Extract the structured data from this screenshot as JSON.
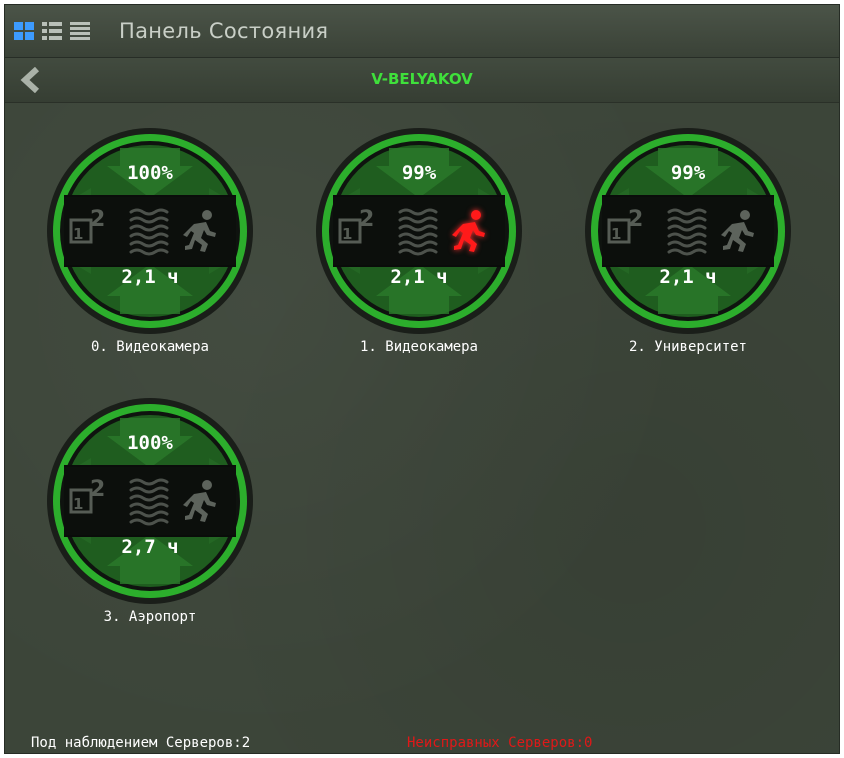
{
  "window": {
    "title": "Панель Состояния"
  },
  "view_modes": [
    "tiles-icon",
    "list-icon",
    "details-icon"
  ],
  "server": {
    "name": "V-BELYAKOV"
  },
  "colors": {
    "ring": "#2fb52f",
    "server_name": "#3fe03b",
    "alarm": "#ff1a1a",
    "faulty_text": "#e01818"
  },
  "cameras": [
    {
      "label": "0. Видеокамера",
      "percent": "100%",
      "time": "2,1 ч",
      "motion_alarm": false
    },
    {
      "label": "1. Видеокамера",
      "percent": "99%",
      "time": "2,1 ч",
      "motion_alarm": true
    },
    {
      "label": "2. Университет",
      "percent": "99%",
      "time": "2,1 ч",
      "motion_alarm": false
    },
    {
      "label": "3. Аэропорт",
      "percent": "100%",
      "time": "2,7 ч",
      "motion_alarm": false
    }
  ],
  "footer": {
    "monitored": "Под наблюдением Серверов:2",
    "faulty": "Неисправных Серверов:0"
  }
}
